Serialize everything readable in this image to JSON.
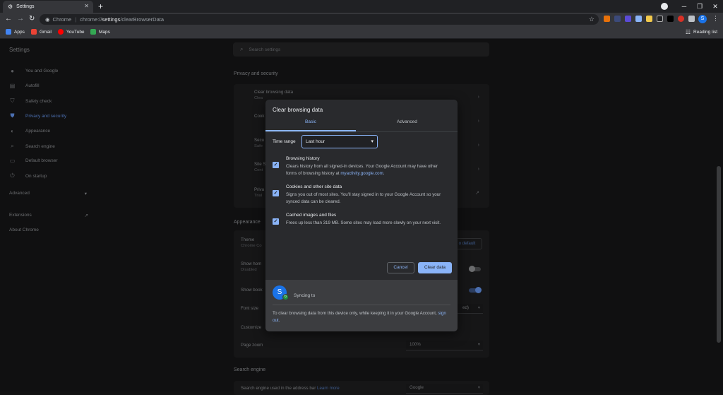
{
  "browser": {
    "tab_title": "Settings",
    "url_chrome": "Chrome",
    "url_scheme": "chrome://",
    "url_host": "settings",
    "url_path": "/clearBrowserData",
    "bookmarks": [
      "Apps",
      "Gmail",
      "YouTube",
      "Maps"
    ],
    "reading_list": "Reading list",
    "profile_initial": "S"
  },
  "settings": {
    "title": "Settings",
    "search_placeholder": "Search settings",
    "sidebar": [
      "You and Google",
      "Autofill",
      "Safety check",
      "Privacy and security",
      "Appearance",
      "Search engine",
      "Default browser",
      "On startup"
    ],
    "advanced": "Advanced",
    "extensions": "Extensions",
    "about": "About Chrome",
    "privacy_heading": "Privacy and security",
    "privacy_rows": [
      {
        "title": "Clear browsing data",
        "sub": "Clea"
      },
      {
        "title": "Cook",
        "sub": ""
      },
      {
        "title": "Secu",
        "sub": "Safe"
      },
      {
        "title": "Site S",
        "sub": "Cont"
      },
      {
        "title": "Priva",
        "sub": "Trial"
      }
    ],
    "appearance_heading": "Appearance",
    "appearance_rows": {
      "theme": "Theme",
      "theme_sub": "Chrome Co",
      "reset": "o default",
      "home": "Show hom",
      "home_sub": "Disabled",
      "bookmarks": "Show book",
      "font_size": "Font size",
      "font_size_value": "ed)",
      "customize": "Customize",
      "page_zoom": "Page zoom",
      "page_zoom_value": "100%"
    },
    "search_heading": "Search engine",
    "search_row": "Search engine used in the address bar",
    "search_row_link": "Learn more",
    "search_value": "Google"
  },
  "dialog": {
    "title": "Clear browsing data",
    "tabs": [
      "Basic",
      "Advanced"
    ],
    "time_range_label": "Time range",
    "time_range_value": "Last hour",
    "options": [
      {
        "title": "Browsing history",
        "desc": "Clears history from all signed-in devices. Your Google Account may have other forms of browsing history at ",
        "link": "myactivity.google.com",
        "desc_end": ".",
        "checked": true
      },
      {
        "title": "Cookies and other site data",
        "desc": "Signs you out of most sites. You'll stay signed in to your Google Account so your synced data can be cleared.",
        "link": "",
        "desc_end": "",
        "checked": true
      },
      {
        "title": "Cached images and files",
        "desc": "Frees up less than 319 MB. Some sites may load more slowly on your next visit.",
        "link": "",
        "desc_end": "",
        "checked": true
      }
    ],
    "cancel": "Cancel",
    "clear": "Clear data",
    "sync_text": "Syncing to",
    "avatar_initial": "S",
    "footer_note": "To clear browsing data from this device only, while keeping it in your Google Account, ",
    "footer_link": "sign out",
    "footer_end": "."
  }
}
